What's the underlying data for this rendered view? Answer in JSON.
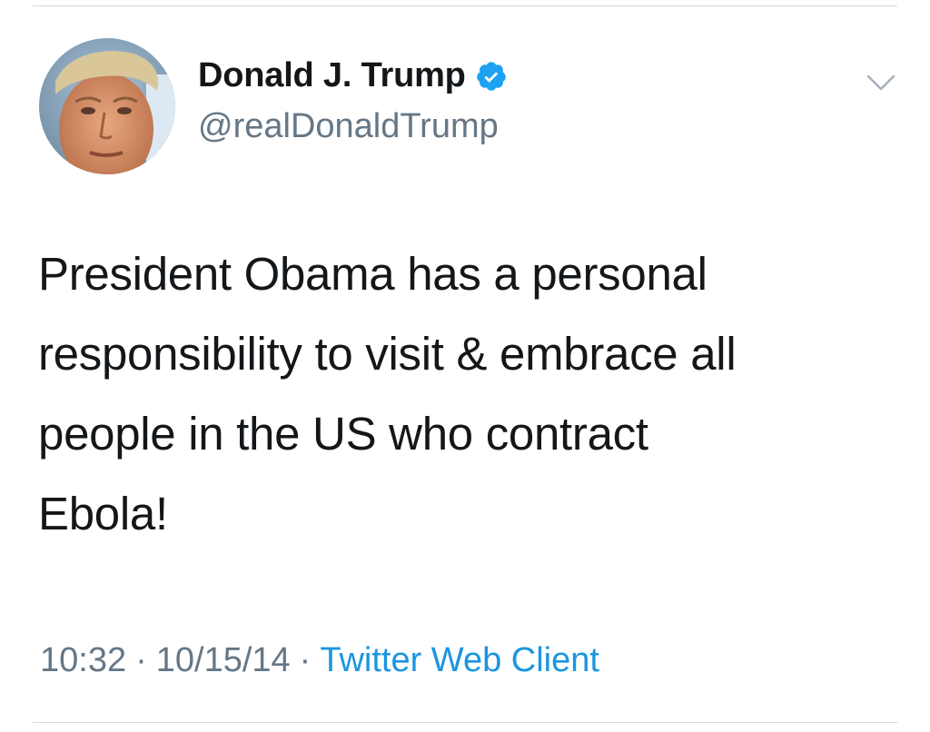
{
  "tweet": {
    "author": {
      "display_name": "Donald J. Trump",
      "handle": "@realDonaldTrump",
      "verified": true,
      "avatar_icon": "profile-photo"
    },
    "text": "President Obama has a personal\nresponsibility to visit & embrace all\npeople in the US who contract\nEbola!",
    "meta": {
      "time": "10:32",
      "separator": "·",
      "date": "10/15/14",
      "source": "Twitter Web Client"
    },
    "menu_icon": "chevron-down-icon"
  },
  "colors": {
    "text_primary": "#14171a",
    "text_secondary": "#657786",
    "link": "#1b95e0",
    "verified_badge": "#1da1f2",
    "divider": "#d4d8dc"
  }
}
